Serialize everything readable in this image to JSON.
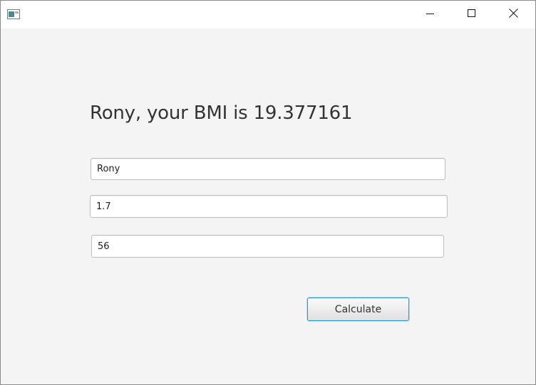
{
  "window": {
    "title": "",
    "icon": "java-window-icon",
    "controls": {
      "minimize_icon": "minimize-icon",
      "maximize_icon": "maximize-icon",
      "close_icon": "close-icon"
    }
  },
  "result": {
    "text": "Rony, your BMI is 19.377161"
  },
  "form": {
    "name_value": "Rony",
    "height_value": "1.7",
    "weight_value": "56",
    "calculate_label": "Calculate"
  },
  "colors": {
    "background": "#f4f4f4",
    "focus_accent": "#2a9bd8",
    "text": "#333333"
  }
}
